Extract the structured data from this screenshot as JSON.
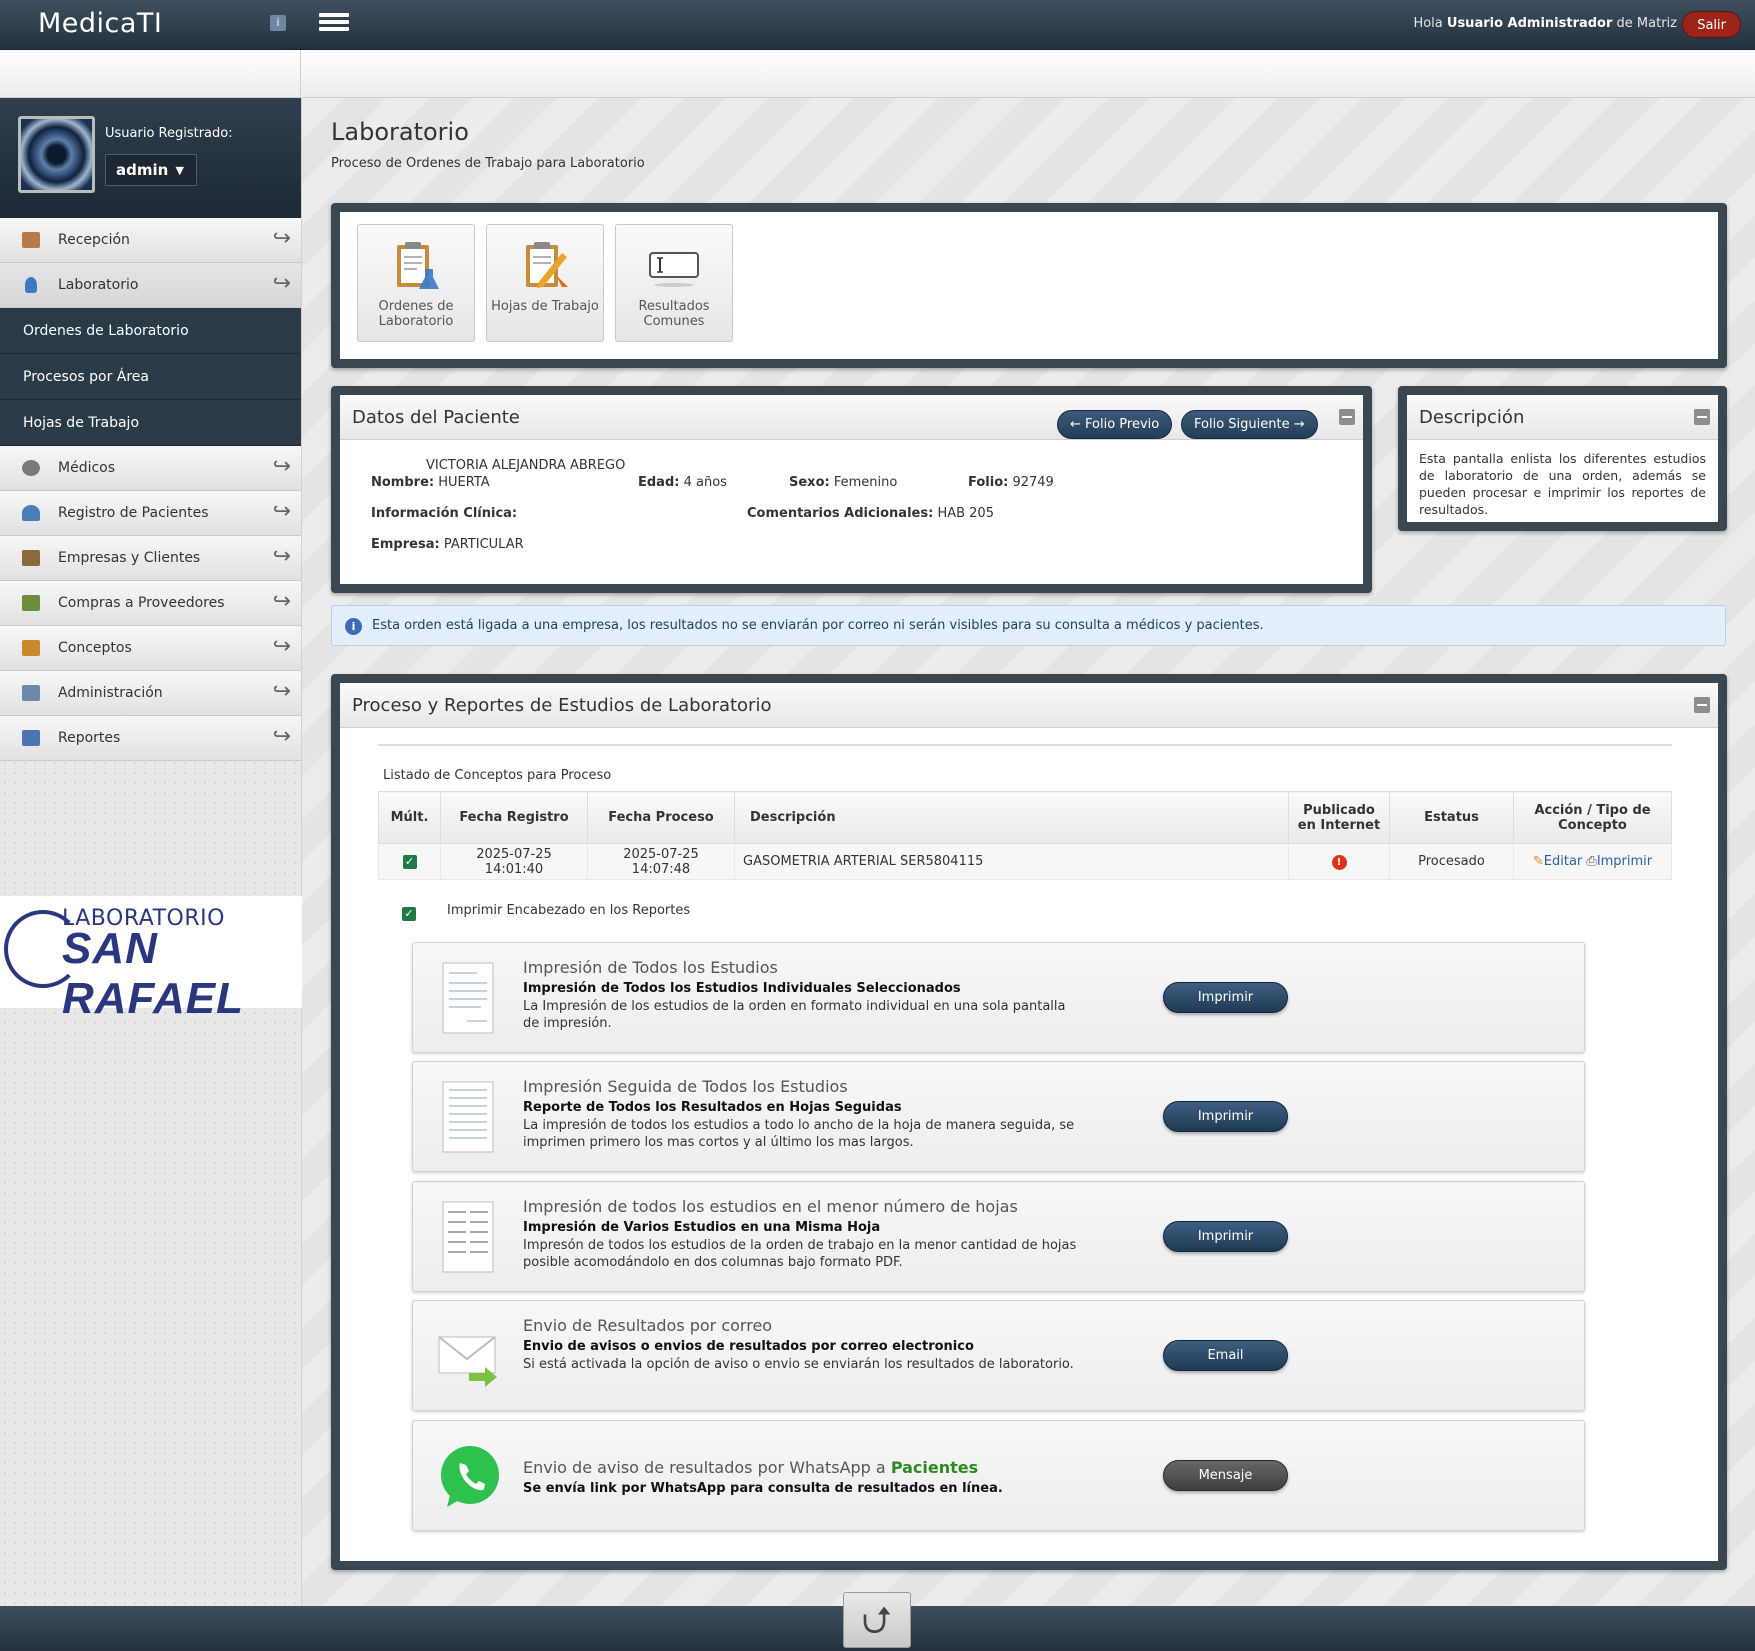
{
  "app": {
    "title": "MedicaTI",
    "info_icon": "info-icon",
    "menu_icon": "hamburger-icon"
  },
  "header": {
    "greeting_prefix": "Hola",
    "user_name": "Usuario Administrador",
    "greeting_suffix": "de Matriz",
    "logout_label": "Salir"
  },
  "user": {
    "label": "Usuario Registrado:",
    "selected": "admin"
  },
  "sidebar": {
    "items": [
      {
        "label": "Recepción",
        "icon": "reception-icon",
        "color": "#b97a4a"
      },
      {
        "label": "Laboratorio",
        "icon": "flask-icon",
        "color": "#3a79c6"
      },
      {
        "label": "Médicos",
        "icon": "stethoscope-icon",
        "color": "#7a7a7a"
      },
      {
        "label": "Registro de Pacientes",
        "icon": "patient-icon",
        "color": "#4a7fb5"
      },
      {
        "label": "Empresas y Clientes",
        "icon": "building-icon",
        "color": "#8a6a3a"
      },
      {
        "label": "Compras a Proveedores",
        "icon": "supplier-icon",
        "color": "#6b8e3a"
      },
      {
        "label": "Conceptos",
        "icon": "box-icon",
        "color": "#c98a2e"
      },
      {
        "label": "Administración",
        "icon": "admin-icon",
        "color": "#6b8aa8"
      },
      {
        "label": "Reportes",
        "icon": "report-icon",
        "color": "#4a74b4"
      }
    ],
    "sub_items": [
      "Ordenes de Laboratorio",
      "Procesos por Área",
      "Hojas de Trabajo"
    ]
  },
  "lab_logo": {
    "line1": "LABORATORIO",
    "line2": "SAN RAFAEL"
  },
  "page": {
    "title": "Laboratorio",
    "subtitle": "Proceso de Ordenes de Trabajo para Laboratorio"
  },
  "toolbar": {
    "buttons": [
      {
        "label": "Ordenes de Laboratorio",
        "icon": "clipboard-flask-icon"
      },
      {
        "label": "Hojas de Trabajo",
        "icon": "clipboard-pencil-icon"
      },
      {
        "label": "Resultados Comunes",
        "icon": "text-field-icon"
      }
    ]
  },
  "patient": {
    "title": "Datos del Paciente",
    "prev_label": "← Folio Previo",
    "next_label": "Folio Siguiente →",
    "name_label": "Nombre:",
    "name_line1": "VICTORIA ALEJANDRA ABREGO",
    "name_line2": "HUERTA",
    "age_label": "Edad:",
    "age": "4 años",
    "sex_label": "Sexo:",
    "sex": "Femenino",
    "folio_label": "Folio:",
    "folio": "92749",
    "clinical_label": "Información Clínica:",
    "clinical": "",
    "comments_label": "Comentarios Adicionales:",
    "comments": "HAB 205",
    "company_label": "Empresa:",
    "company": "PARTICULAR"
  },
  "description": {
    "title": "Descripción",
    "text": "Esta pantalla enlista los diferentes estudios de laboratorio de una orden, además se pueden procesar e imprimir los reportes de resultados."
  },
  "alert": {
    "text": "Esta orden está ligada a una empresa, los resultados no se enviarán por correo ni serán visibles para su consulta a médicos y pacientes."
  },
  "process": {
    "title": "Proceso y Reportes de Estudios de Laboratorio",
    "list_label": "Listado de Conceptos para Proceso",
    "columns": [
      "Múlt.",
      "Fecha Registro",
      "Fecha Proceso",
      "Descripción",
      "Publicado en Internet",
      "Estatus",
      "Acción / Tipo de Concepto"
    ],
    "rows": [
      {
        "checked": true,
        "registered": "2025-07-25 14:01:40",
        "processed": "2025-07-25 14:07:48",
        "description": "GASOMETRIA ARTERIAL SER5804115",
        "published_icon": "warning-red-icon",
        "status": "Procesado",
        "edit_label": "Editar",
        "print_label": "Imprimir"
      }
    ],
    "header_print_label": "Imprimir Encabezado en los Reportes",
    "options": [
      {
        "title": "Impresión de Todos los Estudios",
        "subtitle": "Impresión de Todos los Estudios Individuales Seleccionados",
        "desc": "La Impresión de los estudios de la orden en formato individual en una sola pantalla de impresión.",
        "button": "Imprimir",
        "icon": "document-icon"
      },
      {
        "title": "Impresión Seguida de Todos los Estudios",
        "subtitle": "Reporte de Todos los Resultados en Hojas Seguidas",
        "desc": "La impresión de todos los estudios a todo lo ancho de la hoja de manera seguida, se imprimen primero los mas cortos y al último los mas largos.",
        "button": "Imprimir",
        "icon": "document-lines-icon"
      },
      {
        "title": "Impresión de todos los estudios en el menor número de hojas",
        "subtitle": "Impresión de Varios Estudios en una Misma Hoja",
        "desc": "Impresón de todos los estudios de la orden de trabajo en la menor cantidad de hojas posible acomodándolo en dos columnas bajo formato PDF.",
        "button": "Imprimir",
        "icon": "document-columns-icon"
      },
      {
        "title": "Envio de Resultados por correo",
        "subtitle": "Envio de avisos o envios de resultados por correo electronico",
        "desc": "Si está activada la opción de aviso o envio se enviarán los resultados de laboratorio.",
        "button": "Email",
        "icon": "envelope-arrow-icon"
      },
      {
        "title": "Envio de aviso de resultados por WhatsApp a",
        "title_highlight": "Pacientes",
        "subtitle": "Se envía link por WhatsApp para consulta de resultados en línea.",
        "desc": "",
        "button": "Mensaje",
        "icon": "whatsapp-icon"
      }
    ]
  },
  "footer": {
    "back_to_top_icon": "arrow-up-icon"
  }
}
